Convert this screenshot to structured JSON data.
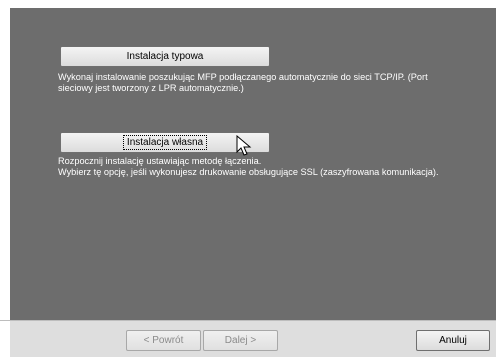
{
  "options": {
    "standard": {
      "button_label": "Instalacja typowa",
      "description": "Wykonaj instalowanie poszukując MFP podłączanego automatycznie do sieci  TCP/IP.  (Port\nsieciowy jest tworzony z  LPR automatycznie.)"
    },
    "custom": {
      "button_label": "Instalacja własna",
      "description": "Rozpocznij  instalację ustawiając metodę łączenia.\nWybierz tę opcję, jeśli wykonujesz drukowanie obsługujące SSL (zaszyfrowana komunikacja)."
    }
  },
  "footer": {
    "back_label": "< Powrót",
    "next_label": "Dalej >",
    "cancel_label": "Anuluj"
  },
  "icons": {
    "cursor": "mouse-pointer-icon"
  }
}
